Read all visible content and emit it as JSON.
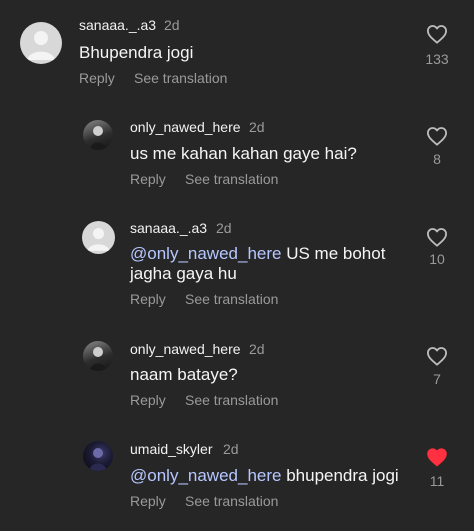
{
  "comments": [
    {
      "username": "sanaaa._.a3",
      "time": "2d",
      "text": "Bhupendra jogi",
      "mention": "",
      "likes": "133",
      "liked": false,
      "reply_label": "Reply",
      "translate_label": "See translation"
    },
    {
      "username": "only_nawed_here",
      "time": "2d",
      "text": "us me kahan kahan gaye hai?",
      "mention": "",
      "likes": "8",
      "liked": false,
      "reply_label": "Reply",
      "translate_label": "See translation"
    },
    {
      "username": "sanaaa._.a3",
      "time": "2d",
      "mention": "@only_nawed_here",
      "text": " US me bohot jagha gaya hu",
      "likes": "10",
      "liked": false,
      "reply_label": "Reply",
      "translate_label": "See translation"
    },
    {
      "username": "only_nawed_here",
      "time": "2d",
      "text": "naam bataye?",
      "mention": "",
      "likes": "7",
      "liked": false,
      "reply_label": "Reply",
      "translate_label": "See translation"
    },
    {
      "username": "umaid_skyler",
      "time": "2d",
      "mention": "@only_nawed_here",
      "text": " bhupendra jogi",
      "likes": "11",
      "liked": true,
      "reply_label": "Reply",
      "translate_label": "See translation"
    }
  ],
  "colors": {
    "background": "#262626",
    "liked_heart": "#ff3040",
    "muted_text": "#9a9a9a",
    "mention": "#b6c7ff"
  }
}
